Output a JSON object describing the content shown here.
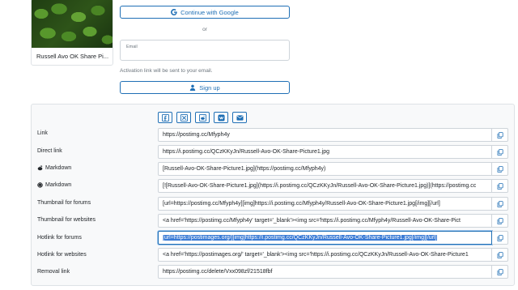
{
  "image_card": {
    "caption": "Russell Avo OK Share Pi..."
  },
  "signup": {
    "google_label": "Continue with Google",
    "or_text": "or",
    "email_placeholder": "Email",
    "activation_note": "Activation link will be sent to your email.",
    "signup_label": "Sign up"
  },
  "share_buttons": [
    "facebook-icon",
    "x-twitter-icon",
    "reddit-icon",
    "vk-icon",
    "email-icon"
  ],
  "colors": {
    "accent": "#1f6fb5",
    "selection": "#3a7bd5"
  },
  "rows": [
    {
      "label": "Link",
      "value": "https://postimg.cc/Mfyph4y"
    },
    {
      "label": "Direct link",
      "value": "https://i.postimg.cc/QCzKKyJn/Russell-Avo-OK-Share-Picture1.jpg"
    },
    {
      "label": "Markdown",
      "icon": "reddit-icon",
      "value": "[Russell-Avo-OK-Share-Picture1.jpg](https://postimg.cc/Mfyph4y)"
    },
    {
      "label": "Markdown",
      "icon": "github-icon",
      "value": "[![Russell-Avo-OK-Share-Picture1.jpg](https://i.postimg.cc/QCzKKyJn/Russell-Avo-OK-Share-Picture1.jpg)](https://postimg.cc"
    },
    {
      "label": "Thumbnail for forums",
      "value": "[url=https://postimg.cc/Mfyph4y][img]https://i.postimg.cc/Mfyph4y/Russell-Avo-OK-Share-Picture1.jpg[/img][/url]"
    },
    {
      "label": "Thumbnail for websites",
      "value": "<a href='https://postimg.cc/Mfyph4y' target='_blank'><img src='https://i.postimg.cc/Mfyph4y/Russell-Avo-OK-Share-Pict"
    },
    {
      "label": "Hotlink for forums",
      "value": "[url=https://postimages.org/][img]https://i.postimg.cc/QCzKKyJn/Russell-Avo-OK-Share-Picture1.jpg[/img][/url]",
      "selected": true
    },
    {
      "label": "Hotlink for websites",
      "value": "<a href='https://postimages.org/' target='_blank'><img src='https://i.postimg.cc/QCzKKyJn/Russell-Avo-OK-Share-Picture1"
    },
    {
      "label": "Removal link",
      "value": "https://postimg.cc/delete/Vxx098zf/21518fbf"
    }
  ]
}
